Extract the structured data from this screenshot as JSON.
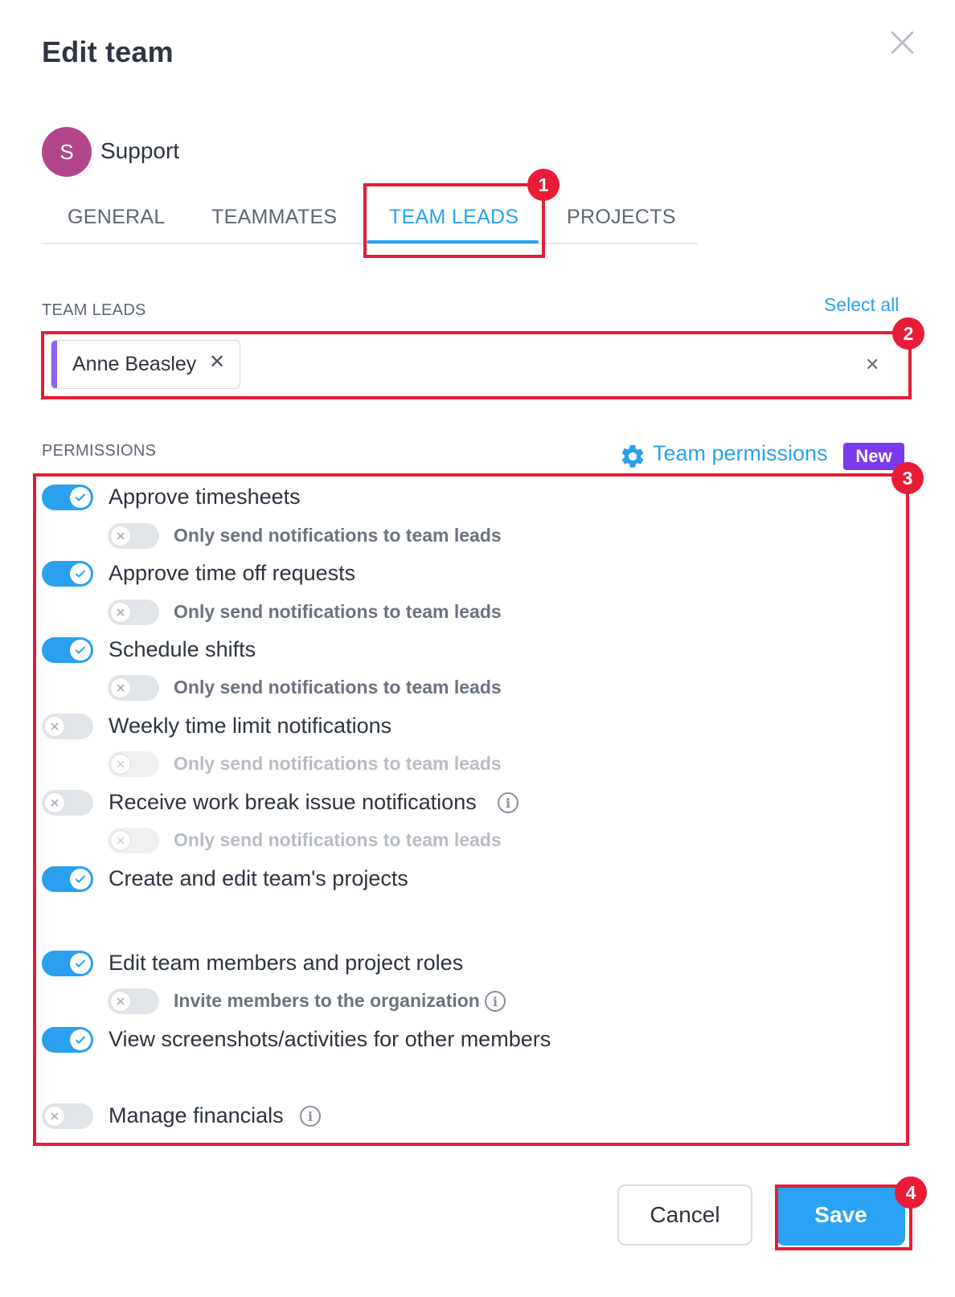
{
  "dialog": {
    "title": "Edit team"
  },
  "team": {
    "avatar_letter": "S",
    "name": "Support",
    "avatar_color": "#b3468a"
  },
  "tabs": [
    {
      "label": "GENERAL",
      "active": false
    },
    {
      "label": "TEAMMATES",
      "active": false
    },
    {
      "label": "TEAM LEADS",
      "active": true
    },
    {
      "label": "PROJECTS",
      "active": false
    }
  ],
  "team_leads": {
    "label": "TEAM LEADS",
    "select_all": "Select all",
    "selected": [
      {
        "name": "Anne Beasley",
        "color": "#8f63f0"
      }
    ]
  },
  "permissions": {
    "label": "PERMISSIONS",
    "team_permissions_link": "Team permissions",
    "new_badge": "New",
    "items": [
      {
        "label": "Approve timesheets",
        "enabled": true,
        "sub": {
          "label": "Only send notifications to team leads",
          "enabled": false,
          "disabled": false
        }
      },
      {
        "label": "Approve time off requests",
        "enabled": true,
        "sub": {
          "label": "Only send notifications to team leads",
          "enabled": false,
          "disabled": false
        }
      },
      {
        "label": "Schedule shifts",
        "enabled": true,
        "sub": {
          "label": "Only send notifications to team leads",
          "enabled": false,
          "disabled": false
        }
      },
      {
        "label": "Weekly time limit notifications",
        "enabled": false,
        "sub": {
          "label": "Only send notifications to team leads",
          "enabled": false,
          "disabled": true
        }
      },
      {
        "label": "Receive work break issue notifications",
        "enabled": false,
        "info": true,
        "sub": {
          "label": "Only send notifications to team leads",
          "enabled": false,
          "disabled": true
        }
      },
      {
        "label": "Create and edit team's projects",
        "enabled": true
      },
      {
        "label": "Edit team members and project roles",
        "enabled": true,
        "sub": {
          "label": "Invite members to the organization",
          "enabled": false,
          "disabled": false,
          "info": true
        }
      },
      {
        "label": "View screenshots/activities for other members",
        "enabled": true
      },
      {
        "label": "Manage financials",
        "enabled": false,
        "info": true
      }
    ]
  },
  "footer": {
    "cancel_label": "Cancel",
    "save_label": "Save"
  },
  "annotations": [
    "1",
    "2",
    "3",
    "4"
  ],
  "colors": {
    "accent": "#2aa0ef",
    "annotation": "#e81c36",
    "badge": "#7c3aed"
  }
}
